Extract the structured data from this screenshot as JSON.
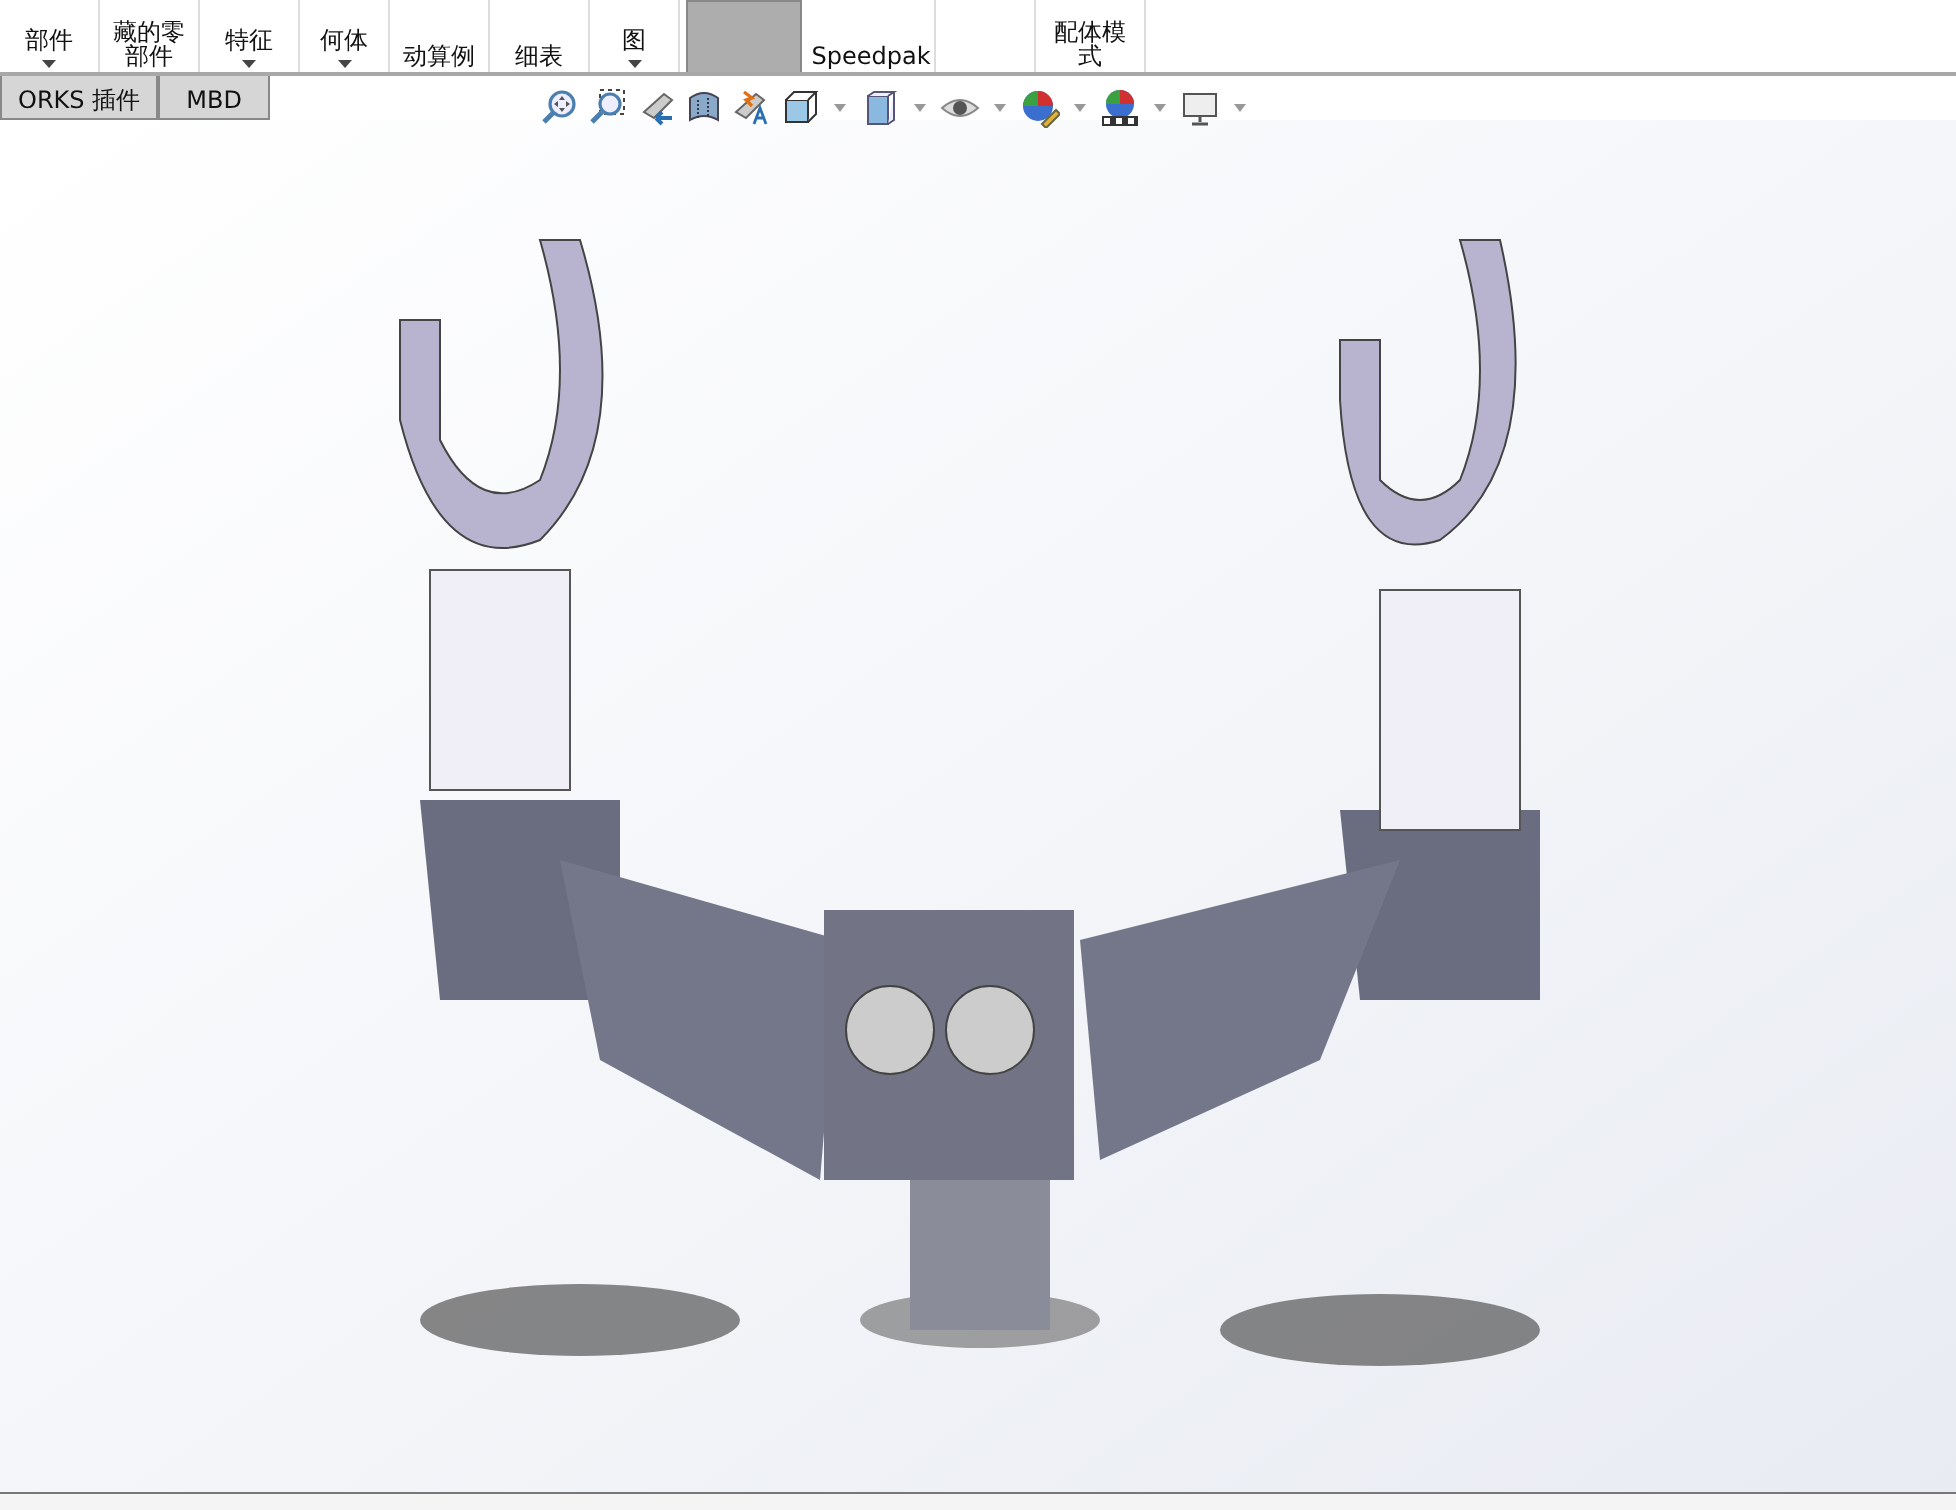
{
  "ribbon": [
    {
      "lines": [
        "部件"
      ],
      "caret": true,
      "selected": false
    },
    {
      "lines": [
        "藏的零",
        "部件"
      ],
      "caret": false,
      "selected": false
    },
    {
      "lines": [
        "特征"
      ],
      "caret": true,
      "selected": false
    },
    {
      "lines": [
        "何体"
      ],
      "caret": true,
      "selected": false
    },
    {
      "lines": [
        "动算例"
      ],
      "caret": false,
      "selected": false
    },
    {
      "lines": [
        "细表"
      ],
      "caret": false,
      "selected": false
    },
    {
      "lines": [
        "图"
      ],
      "caret": true,
      "selected": false
    },
    {
      "caret": false,
      "selected": true
    },
    {
      "lines": [
        "Speedpak"
      ],
      "caret": false,
      "selected": false
    },
    {
      "caret": false,
      "selected": false
    },
    {
      "lines": [
        "配体模",
        "式"
      ],
      "caret": false,
      "selected": false
    }
  ],
  "tabs": [
    {
      "label": "ORKS 插件",
      "selected": false
    },
    {
      "label": "MBD",
      "selected": false
    }
  ],
  "view_toolbar": [
    {
      "kind": "zoom-fit",
      "caret": false
    },
    {
      "kind": "zoom-area",
      "caret": false
    },
    {
      "kind": "previous-view",
      "caret": false
    },
    {
      "kind": "section",
      "caret": false
    },
    {
      "kind": "dynamic-annotation",
      "caret": false
    },
    {
      "kind": "view-orientation",
      "caret": true
    },
    {
      "kind": "display-style",
      "caret": true
    },
    {
      "kind": "hide-show",
      "caret": true
    },
    {
      "kind": "edit-appearance",
      "caret": true
    },
    {
      "kind": "scene",
      "caret": true
    },
    {
      "kind": "view-settings",
      "caret": true
    }
  ]
}
